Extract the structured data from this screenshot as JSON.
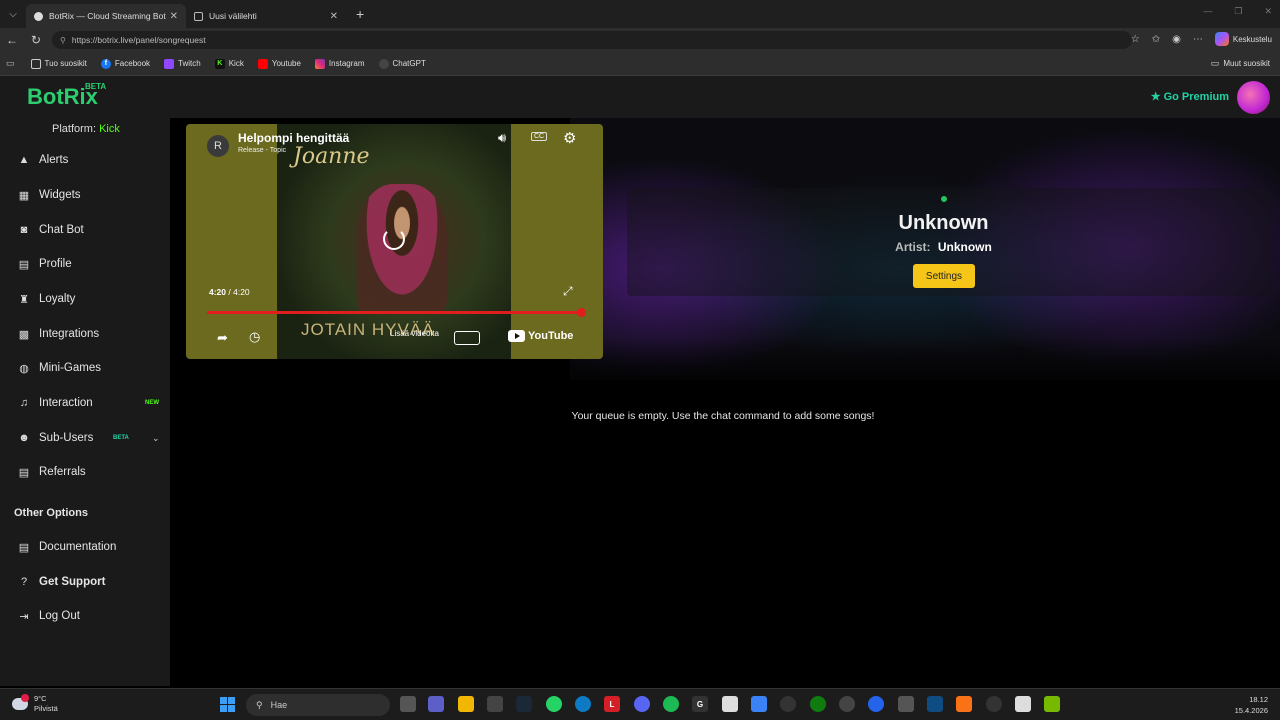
{
  "browser": {
    "tabs": [
      {
        "label": "BotRix — Cloud Streaming Bot for",
        "active": true
      },
      {
        "label": "Uusi välilehti",
        "active": false
      }
    ],
    "url": "https://botrix.live/panel/songrequest",
    "chat_label": "Keskustelu",
    "bookmarks": [
      "Tuo suosikit",
      "Facebook",
      "Twitch",
      "Kick",
      "Youtube",
      "Instagram",
      "ChatGPT"
    ],
    "other_bookmarks": "Muut suosikit"
  },
  "header": {
    "logo": "BotRix",
    "logo_badge": "BETA",
    "premium_label": "Go Premium"
  },
  "sidebar": {
    "platform_label": "Platform:",
    "platform_value": "Kick",
    "items": [
      {
        "label": "Alerts",
        "icon": "alert-triangle-icon"
      },
      {
        "label": "Widgets",
        "icon": "grid-icon"
      },
      {
        "label": "Chat Bot",
        "icon": "robot-icon"
      },
      {
        "label": "Profile",
        "icon": "id-card-icon"
      },
      {
        "label": "Loyalty",
        "icon": "trophy-icon"
      },
      {
        "label": "Integrations",
        "icon": "puzzle-icon"
      },
      {
        "label": "Mini-Games",
        "icon": "gamepad-icon"
      },
      {
        "label": "Interaction",
        "icon": "music-icon",
        "badge": "NEW"
      },
      {
        "label": "Sub-Users",
        "icon": "users-icon",
        "badge": "BETA"
      },
      {
        "label": "Referrals",
        "icon": "list-icon"
      }
    ],
    "other_options_heading": "Other Options",
    "other_items": [
      {
        "label": "Documentation",
        "icon": "document-icon"
      },
      {
        "label": "Get Support",
        "icon": "help-circle-icon"
      },
      {
        "label": "Log Out",
        "icon": "logout-icon"
      }
    ]
  },
  "player": {
    "channel_initial": "R",
    "title": "Helpompi hengittää",
    "subtitle": "Release - Topic",
    "cover_title": "Joanne",
    "cover_caption": "JOTAIN HYVÄÄ",
    "time_current": "4:20",
    "time_total": "4:20",
    "progress_fraction": 1.0,
    "watch_later": "Lisää videoita",
    "brand": "YouTube"
  },
  "now_playing": {
    "title": "Unknown",
    "artist_label": "Artist:",
    "artist_value": "Unknown",
    "settings_label": "Settings"
  },
  "queue": {
    "empty_message": "Your queue is empty. Use the chat command to add some songs!"
  },
  "taskbar": {
    "temperature": "9°C",
    "weather": "Pilvistä",
    "search_placeholder": "Hae",
    "time": "18.12",
    "date": "15.4.2026"
  },
  "colors": {
    "brand_green": "#2ecc71",
    "premium": "#22d3a5",
    "kick_green": "#53fc18",
    "settings_yellow": "#f5c518",
    "progress_red": "#e11d1d"
  }
}
